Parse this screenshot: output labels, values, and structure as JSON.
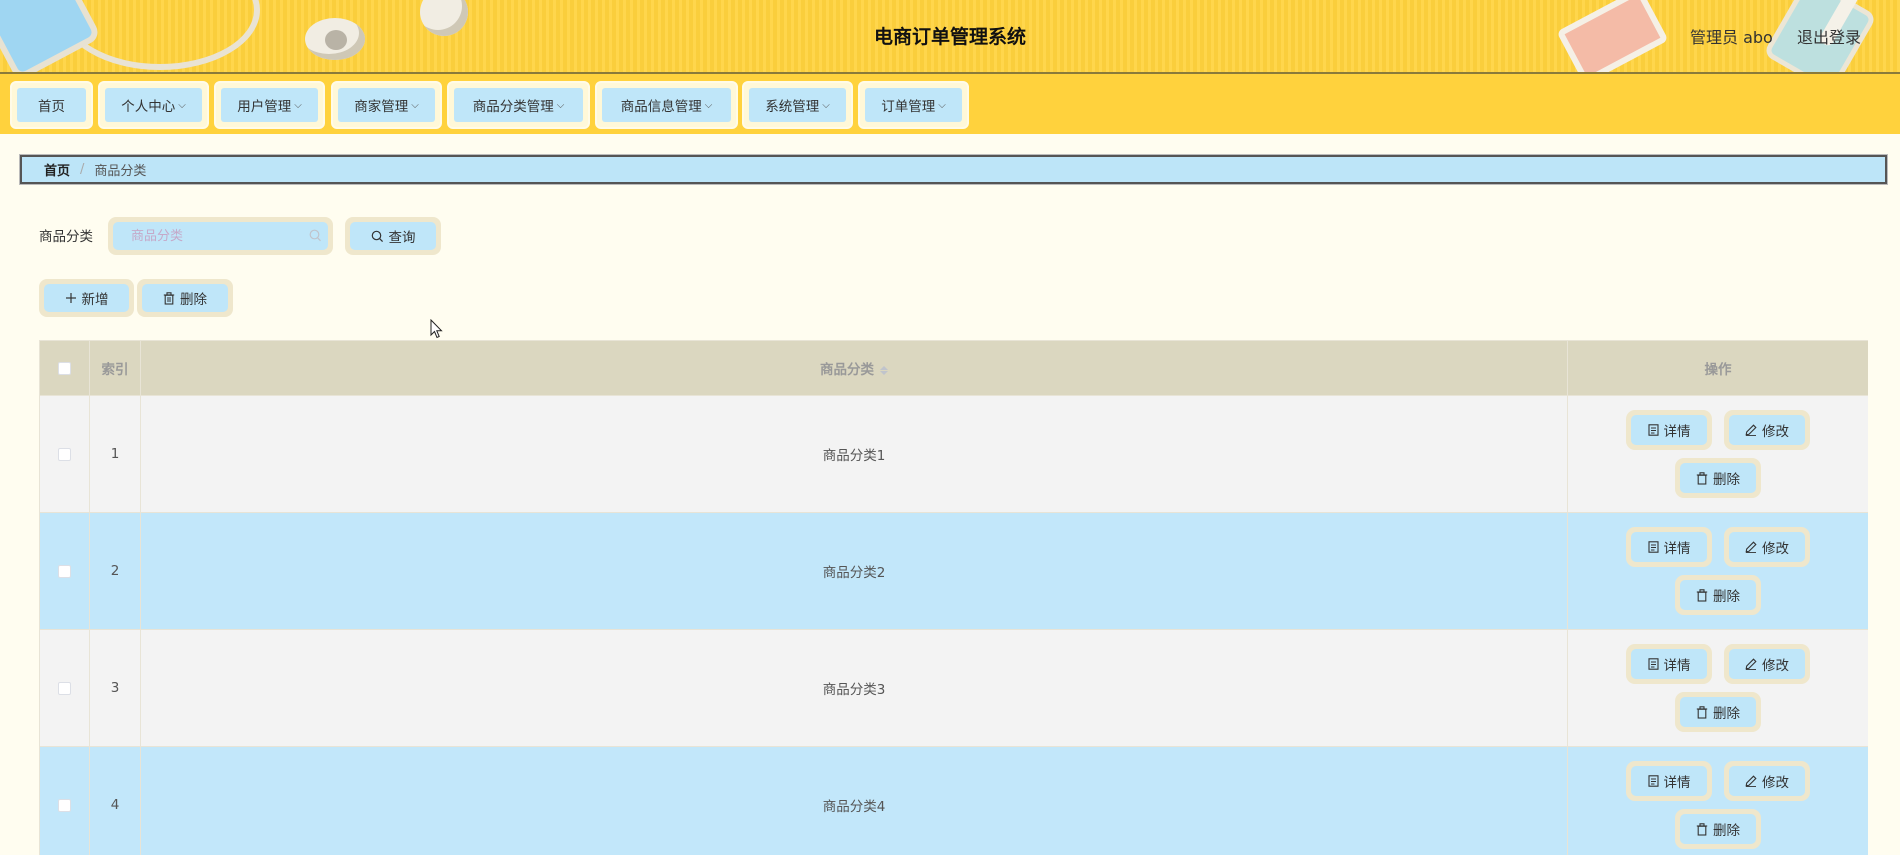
{
  "header": {
    "title": "电商订单管理系统",
    "admin": "管理员 abo",
    "logout": "退出登录"
  },
  "nav": {
    "items": [
      {
        "label": "首页",
        "has_dropdown": false
      },
      {
        "label": "个人中心",
        "has_dropdown": true
      },
      {
        "label": "用户管理",
        "has_dropdown": true
      },
      {
        "label": "商家管理",
        "has_dropdown": true
      },
      {
        "label": "商品分类管理",
        "has_dropdown": true
      },
      {
        "label": "商品信息管理",
        "has_dropdown": true
      },
      {
        "label": "系统管理",
        "has_dropdown": true
      },
      {
        "label": "订单管理",
        "has_dropdown": true
      }
    ]
  },
  "breadcrumb": {
    "home": "首页",
    "separator": "/",
    "current": "商品分类"
  },
  "search": {
    "label": "商品分类",
    "placeholder": "商品分类",
    "value": "",
    "query_button": "查询"
  },
  "actions": {
    "add": "新增",
    "delete": "删除"
  },
  "table": {
    "columns": [
      "索引",
      "商品分类",
      "操作"
    ],
    "rows": [
      {
        "index": "1",
        "category": "商品分类1"
      },
      {
        "index": "2",
        "category": "商品分类2"
      },
      {
        "index": "3",
        "category": "商品分类3"
      },
      {
        "index": "4",
        "category": "商品分类4"
      }
    ],
    "row_actions": {
      "detail": "详情",
      "edit": "修改",
      "delete": "删除"
    }
  },
  "colors": {
    "header_bg": "#ffd23d",
    "button_bg": "#bfe6f9",
    "button_border": "#efe7cc",
    "row_alt_bg": "#c2e7fa",
    "table_header_bg": "#dbd7c0",
    "page_bg": "#fffdf0"
  }
}
